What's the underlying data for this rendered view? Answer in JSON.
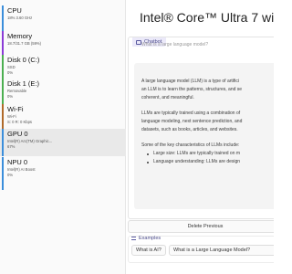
{
  "left": {
    "items": [
      {
        "name": "CPU",
        "sub": "18%  3.60 GHz",
        "sub2": "",
        "accent": "#3b8edb"
      },
      {
        "name": "Memory",
        "sub": "18.7/31.7 GB (59%)",
        "sub2": "",
        "accent": "#8a3bd6"
      },
      {
        "name": "Disk 0 (C:)",
        "sub": "SSD",
        "sub2": "0%",
        "accent": "#4caf50"
      },
      {
        "name": "Disk 1 (E:)",
        "sub": "Removable",
        "sub2": "0%",
        "accent": "#4caf50"
      },
      {
        "name": "Wi-Fi",
        "sub": "Wi-Fi",
        "sub2": "S: 0  R: 0 Kbps",
        "accent": "#b06a2a"
      },
      {
        "name": "GPU 0",
        "sub": "Intel(R) Arc(TM) Graphic...",
        "sub2": "67%",
        "accent": "#3b8edb"
      },
      {
        "name": "NPU 0",
        "sub": "Intel(R) AI Boost",
        "sub2": "0%",
        "accent": "#3b8edb"
      }
    ]
  },
  "app": {
    "title": "Intel® Core™ Ultra 7 with",
    "chatbot_label": "Chatbot",
    "faded_text": "What is a large language model?",
    "message": {
      "p1_line1": "A large language model (LLM) is a type of artifici",
      "p1_line2": "an LLM is to learn the patterns, structures, and se",
      "p1_line3": "coherent, and meaningful.",
      "p2_line1": "LLMs are typically trained using a combination of",
      "p2_line2": "language modeling, next sentence prediction, and",
      "p2_line3": "datasets, such as books, articles, and websites.",
      "p3_line1": "Some of the key characteristics of LLMs include:",
      "bullet1": "Large size: LLMs are typically trained on m",
      "bullet2": "Language understanding: LLMs are design"
    },
    "delete_label": "Delete Previous",
    "examples_label": "Examples",
    "examples": [
      "What is AI?",
      "What is a Large Language Model?"
    ]
  }
}
